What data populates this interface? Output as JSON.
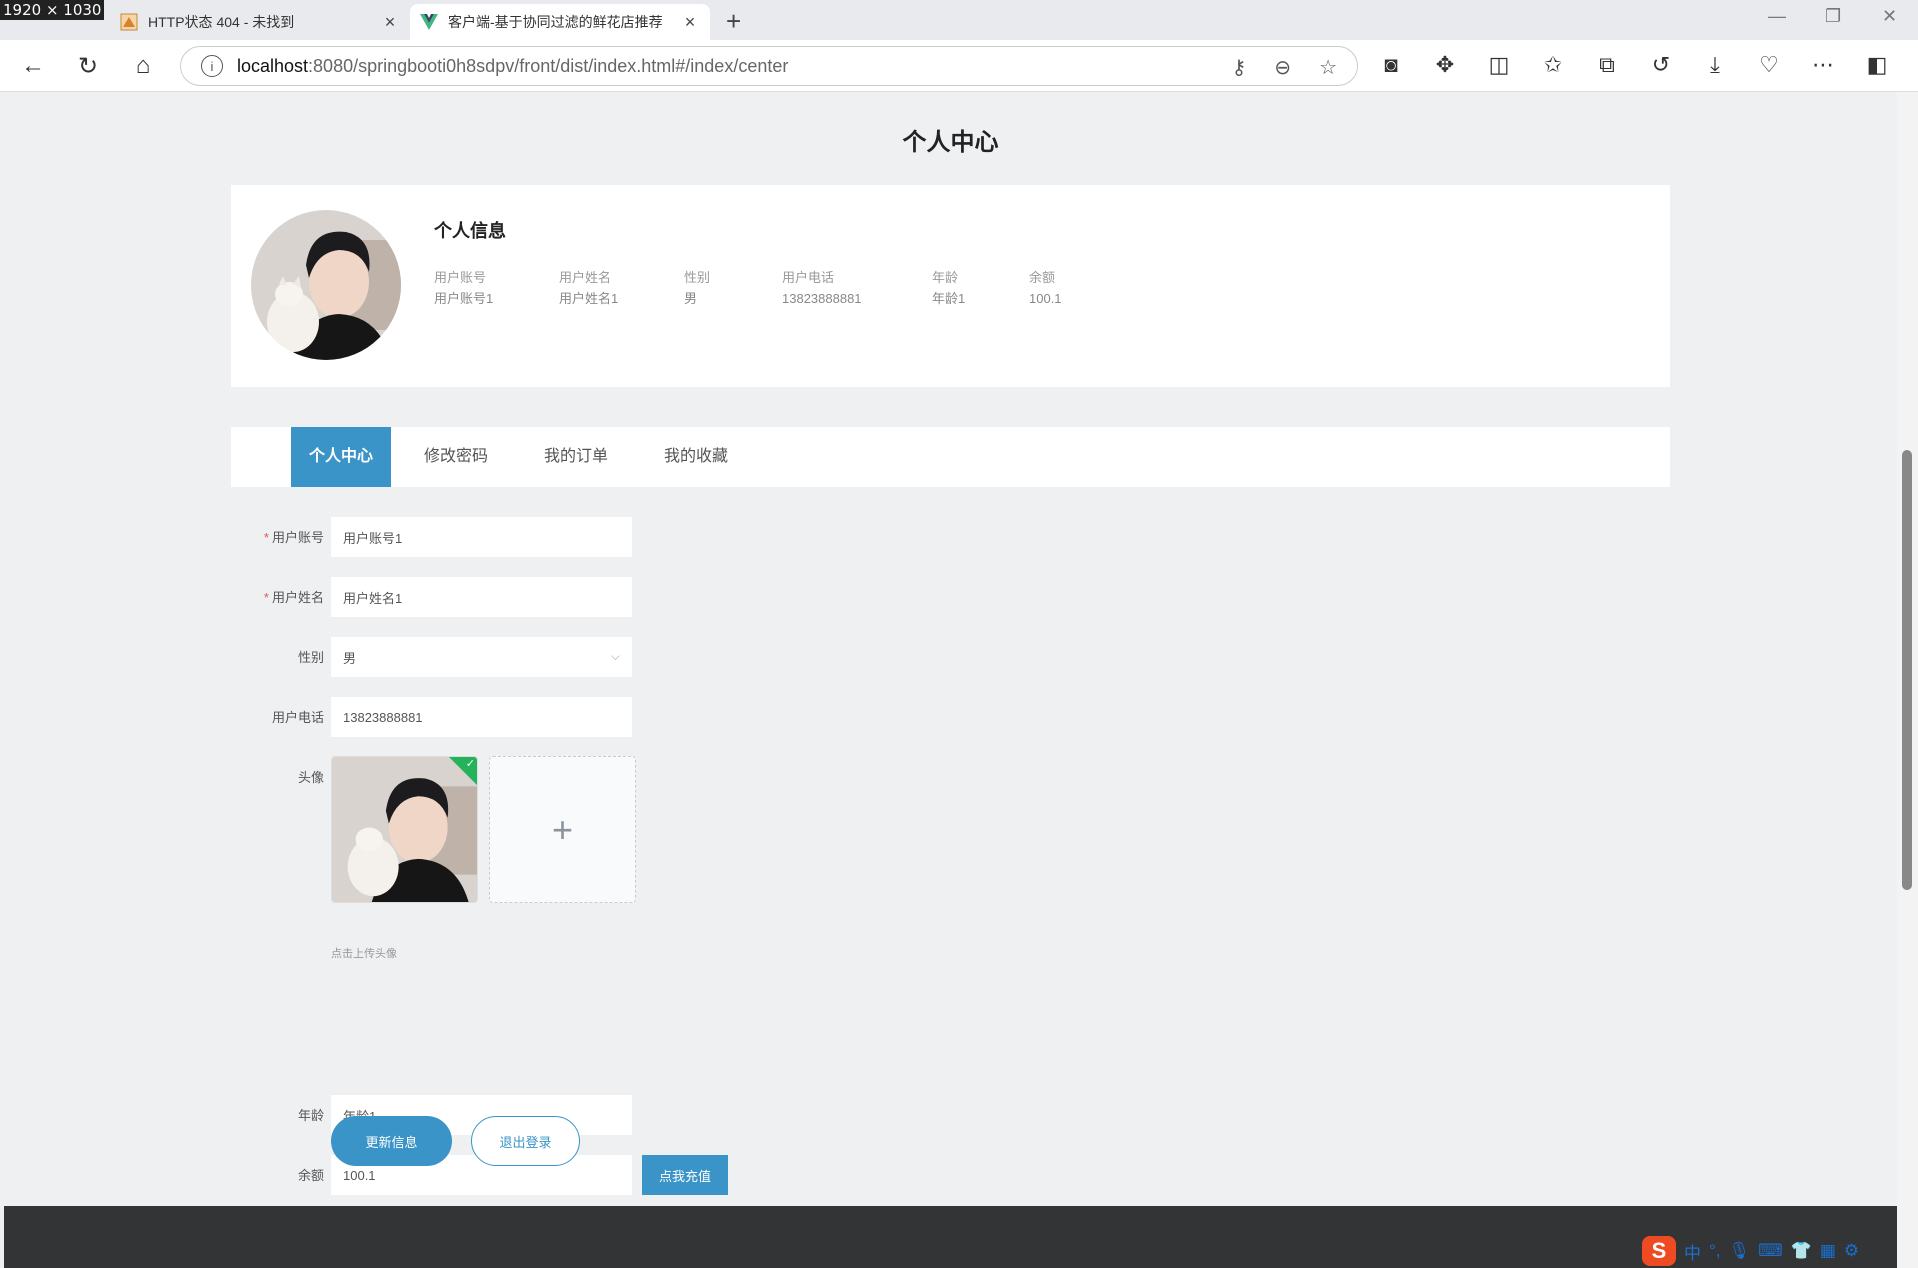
{
  "screen_size_badge": "1920 × 1030",
  "browser": {
    "tabs": [
      {
        "title": "HTTP状态 404 - 未找到",
        "active": false
      },
      {
        "title": "客户端-基于协同过滤的鲜花店推荐",
        "active": true
      }
    ],
    "url_host": "localhost",
    "url_rest": ":8080/springbooti0h8sdpv/front/dist/index.html#/index/center"
  },
  "page": {
    "title": "个人中心",
    "profile_card": {
      "heading": "个人信息",
      "fields": [
        {
          "label": "用户账号",
          "value": "用户账号1"
        },
        {
          "label": "用户姓名",
          "value": "用户姓名1"
        },
        {
          "label": "性别",
          "value": "男"
        },
        {
          "label": "用户电话",
          "value": "13823888881"
        },
        {
          "label": "年龄",
          "value": "年龄1"
        },
        {
          "label": "余额",
          "value": "100.1"
        }
      ]
    },
    "tabs": [
      {
        "label": "个人中心",
        "active": true
      },
      {
        "label": "修改密码",
        "active": false
      },
      {
        "label": "我的订单",
        "active": false
      },
      {
        "label": "我的收藏",
        "active": false
      }
    ],
    "form": {
      "account_label": "用户账号",
      "account_value": "用户账号1",
      "name_label": "用户姓名",
      "name_value": "用户姓名1",
      "gender_label": "性别",
      "gender_value": "男",
      "phone_label": "用户电话",
      "phone_value": "13823888881",
      "avatar_label": "头像",
      "upload_tip": "点击上传头像",
      "age_label": "年龄",
      "age_value": "年龄1",
      "balance_label": "余额",
      "balance_value": "100.1",
      "recharge_button": "点我充值",
      "update_button": "更新信息",
      "logout_button": "退出登录"
    }
  },
  "colors": {
    "accent": "#3a94c7",
    "page_bg": "#eef0f2",
    "footer_bg": "#333436",
    "required_star": "#e45656",
    "upload_ok": "#24b25a"
  }
}
